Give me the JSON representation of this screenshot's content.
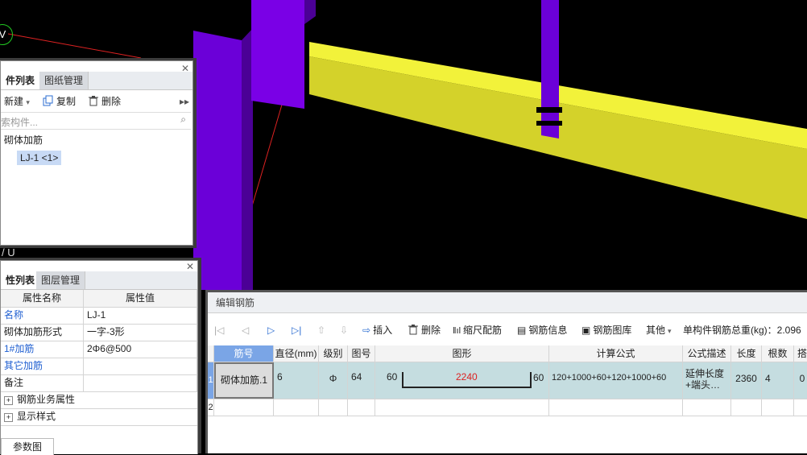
{
  "viewport": {
    "axis_marker_label": "V",
    "grid_label_partial": "/ U"
  },
  "component_panel": {
    "tabs": [
      "件列表",
      "图纸管理"
    ],
    "toolbar": {
      "new": "新建",
      "copy": "复制",
      "delete": "删除"
    },
    "search_placeholder": "索构件...",
    "tree": {
      "category": "砌体加筋",
      "item": "LJ-1 <1>"
    }
  },
  "property_panel": {
    "tabs": [
      "性列表",
      "图层管理"
    ],
    "header": {
      "name": "属性名称",
      "value": "属性值"
    },
    "rows": [
      {
        "name": "名称",
        "value": "LJ-1"
      },
      {
        "name": "砌体加筋形式",
        "value": "一字-3形"
      },
      {
        "name": "1#加筋",
        "value": "2Φ6@500"
      },
      {
        "name": "其它加筋",
        "value": ""
      },
      {
        "name": "备注",
        "value": ""
      },
      {
        "name": "钢筋业务属性",
        "value": ""
      },
      {
        "name": "显示样式",
        "value": ""
      }
    ],
    "bottom_tab": "参数图"
  },
  "rebar_editor": {
    "title": "编辑钢筋",
    "toolbar": {
      "insert": "插入",
      "delete": "删除",
      "scale_rebar": "缩尺配筋",
      "rebar_info": "钢筋信息",
      "rebar_library": "钢筋图库",
      "other": "其他",
      "total_weight_label": "单构件钢筋总重(kg)：2.096"
    },
    "columns": [
      "筋号",
      "直径(mm)",
      "级别",
      "图号",
      "图形",
      "计算公式",
      "公式描述",
      "长度",
      "根数",
      "搭"
    ],
    "rows": [
      {
        "index": "1",
        "name": "砌体加筋.1",
        "diameter": "6",
        "grade": "Φ",
        "figure_no": "64",
        "shape": {
          "left": "60",
          "mid": "2240",
          "right": "60"
        },
        "formula": "120+1000+60+120+1000+60",
        "description": "延伸长度+端头…",
        "length": "2360",
        "count": "4",
        "lap": "0"
      },
      {
        "index": "2"
      }
    ]
  }
}
